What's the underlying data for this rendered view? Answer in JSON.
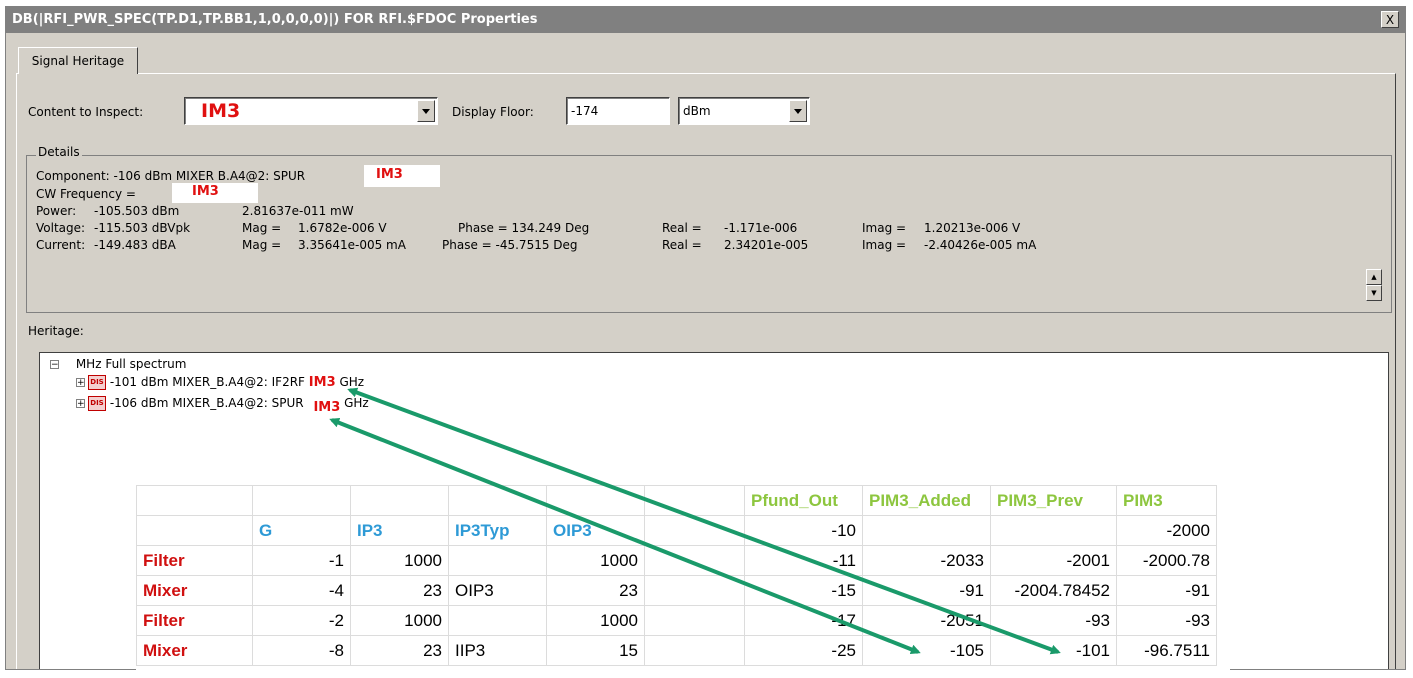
{
  "window": {
    "title": "DB(|RFI_PWR_SPEC(TP.D1,TP.BB1,1,0,0,0,0)|) FOR RFI.$FDOC Properties",
    "close_label": "X"
  },
  "tabs": [
    {
      "label": "Signal Heritage"
    }
  ],
  "content_to_inspect": {
    "label": "Content to Inspect:",
    "value": "IM3"
  },
  "display_floor": {
    "label": "Display Floor:",
    "value": "-174",
    "unit": "dBm"
  },
  "details": {
    "label": "Details",
    "component_prefix": "Component: -106 dBm MIXER  B.A4@2: SPUR",
    "component_tag": "IM3",
    "cw_prefix": "CW Frequency =",
    "cw_tag": "IM3",
    "power": {
      "label": "Power:",
      "dbm": "-105.503 dBm",
      "mw": "2.81637e-011 mW"
    },
    "voltage": {
      "label": "Voltage:",
      "value": "-115.503 dBVpk",
      "mag_label": "Mag =",
      "mag": "1.6782e-006 V",
      "phase": "Phase = 134.249 Deg",
      "real_label": "Real =",
      "real": "-1.171e-006",
      "imag_label": "Imag =",
      "imag": "1.20213e-006 V"
    },
    "current": {
      "label": "Current:",
      "value": "-149.483 dBA",
      "mag_label": "Mag =",
      "mag": "3.35641e-005 mA",
      "phase": "Phase = -45.7515 Deg",
      "real_label": "Real =",
      "real": "2.34201e-005",
      "imag_label": "Imag =",
      "imag": "-2.40426e-005 mA"
    }
  },
  "heritage": {
    "label": "Heritage:",
    "root": {
      "expander": "−",
      "label": "MHz Full spectrum"
    },
    "nodes": [
      {
        "expander": "+",
        "badge": "DIS",
        "text": "-101 dBm MIXER_B.A4@2: IF2RF",
        "tag": "IM3",
        "suffix": "GHz"
      },
      {
        "expander": "+",
        "badge": "DIS",
        "text": "-106 dBm MIXER_B.A4@2: SPUR",
        "tag": "IM3",
        "suffix": "GHz"
      }
    ]
  },
  "table": {
    "header1": [
      "",
      "",
      "",
      "",
      "",
      "",
      "Pfund_Out",
      "PIM3_Added",
      "PIM3_Prev",
      "PIM3"
    ],
    "header2": [
      "",
      "G",
      "IP3",
      "IP3Typ",
      "OIP3",
      "",
      "-10",
      "",
      "",
      "-2000"
    ],
    "rows": [
      [
        "Filter",
        "-1",
        "1000",
        "",
        "1000",
        "",
        "-11",
        "-2033",
        "-2001",
        "-2000.78"
      ],
      [
        "Mixer",
        "-4",
        "23",
        "OIP3",
        "23",
        "",
        "-15",
        "-91",
        "-2004.78452",
        "-91"
      ],
      [
        "Filter",
        "-2",
        "1000",
        "",
        "1000",
        "",
        "-17",
        "-2051",
        "-93",
        "-93"
      ],
      [
        "Mixer",
        "-8",
        "23",
        "IIP3",
        "15",
        "",
        "-25",
        "-105",
        "-101",
        "-96.7511"
      ]
    ]
  },
  "colors": {
    "arrow": "#1a9a6a",
    "tag_red": "#e01010",
    "header_blue": "#2e9ad6",
    "header_green": "#8dc63f",
    "row_red": "#d01010"
  },
  "icons": {
    "close": "close-icon",
    "dropdown": "chevron-down-icon",
    "scroll_up": "scroll-up-icon",
    "scroll_down": "scroll-down-icon"
  }
}
